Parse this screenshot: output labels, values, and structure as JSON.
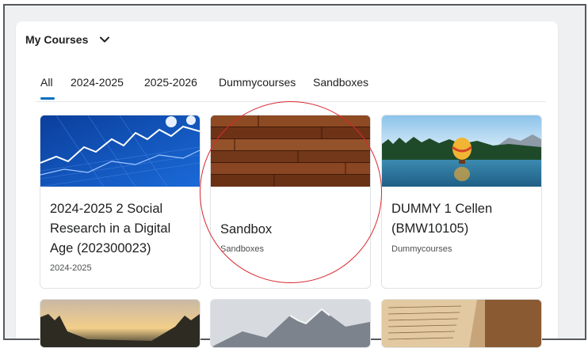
{
  "widget": {
    "title": "My Courses"
  },
  "tabs": [
    {
      "label": "All",
      "active": true
    },
    {
      "label": "2024-2025"
    },
    {
      "label": "2025-2026"
    },
    {
      "label": "Dummycourses"
    },
    {
      "label": "Sandboxes"
    }
  ],
  "courses": [
    {
      "title": "2024-2025 2 Social Research in a Digital Age (202300023)",
      "semester": "2024-2025",
      "image": "stock-chart"
    },
    {
      "title": "Sandbox",
      "semester": "Sandboxes",
      "image": "wood-planks"
    },
    {
      "title": "DUMMY 1 Cellen (BMW10105)",
      "semester": "Dummycourses",
      "image": "hot-air-balloon-lake"
    }
  ],
  "colors": {
    "accent": "#006fbf",
    "highlight_circle": "#d9282f"
  }
}
